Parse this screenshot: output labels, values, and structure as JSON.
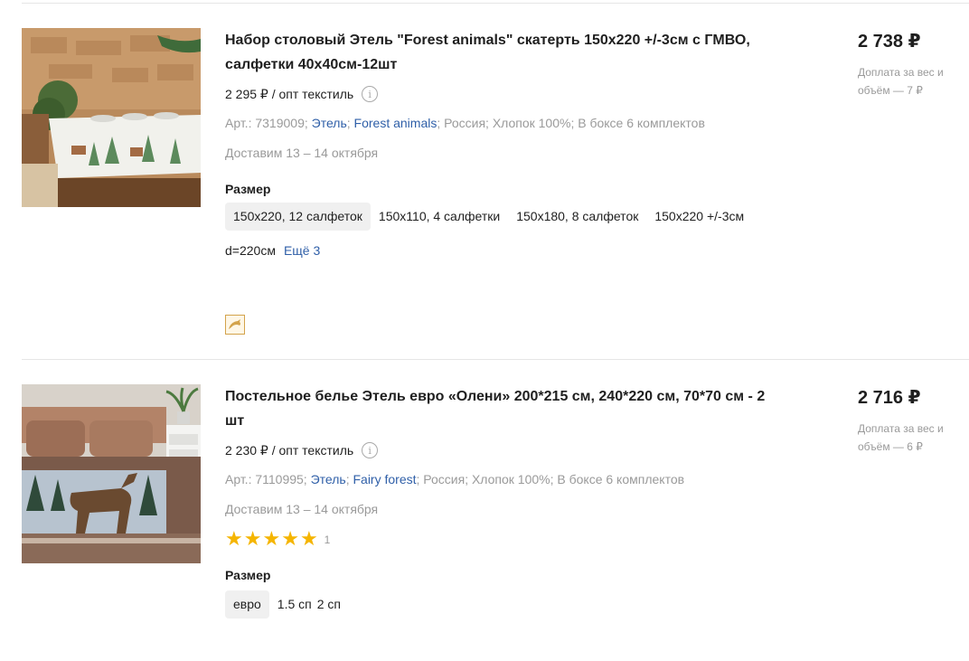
{
  "products": [
    {
      "title": "Набор столовый Этель \"Forest animals\" скатерть 150х220 +/-3см с ГМВО, салфетки 40х40см-12шт",
      "opt_price": "2 295 ₽ / опт текстиль",
      "info_icon": "info-icon",
      "meta": {
        "art": "Арт.: 7319009;",
        "brand": "Этель",
        "brand_sep": ";",
        "collection": "Forest animals",
        "collection_sep": ";",
        "rest": "Россия; Хлопок 100%; В боксе 6 комплектов"
      },
      "delivery": "Доставим 13 – 14 октября",
      "size_label": "Размер",
      "sizes": [
        "150х220, 12 салфеток",
        "150х110, 4 салфетки",
        "150х180, 8 салфеток",
        "150х220 +/-3см d=220см"
      ],
      "more_label": "Ещё 3",
      "promo_icon": "dolphin-icon",
      "price": "2 738 ₽",
      "surcharge": "Доплата за вес и объём — 7 ₽"
    },
    {
      "title": "Постельное белье Этель евро «Олени» 200*215 см, 240*220 см, 70*70 см - 2 шт",
      "opt_price": "2 230 ₽ / опт текстиль",
      "info_icon": "info-icon",
      "meta": {
        "art": "Арт.: 7110995;",
        "brand": "Этель",
        "brand_sep": ";",
        "collection": "Fairy forest",
        "collection_sep": ";",
        "rest": "Россия; Хлопок 100%; В боксе 6 комплектов"
      },
      "delivery": "Доставим 13 – 14 октября",
      "rating": 5,
      "rating_count": "1",
      "size_label": "Размер",
      "sizes": [
        "евро",
        "1.5 сп",
        "2 сп"
      ],
      "price": "2 716 ₽",
      "surcharge": "Доплата за вес и объём — 6 ₽"
    }
  ],
  "colors": {
    "link": "#2f5fa8",
    "muted": "#9a9a9a",
    "star": "#f5b500",
    "chip_selected_bg": "#f0f0f0"
  }
}
